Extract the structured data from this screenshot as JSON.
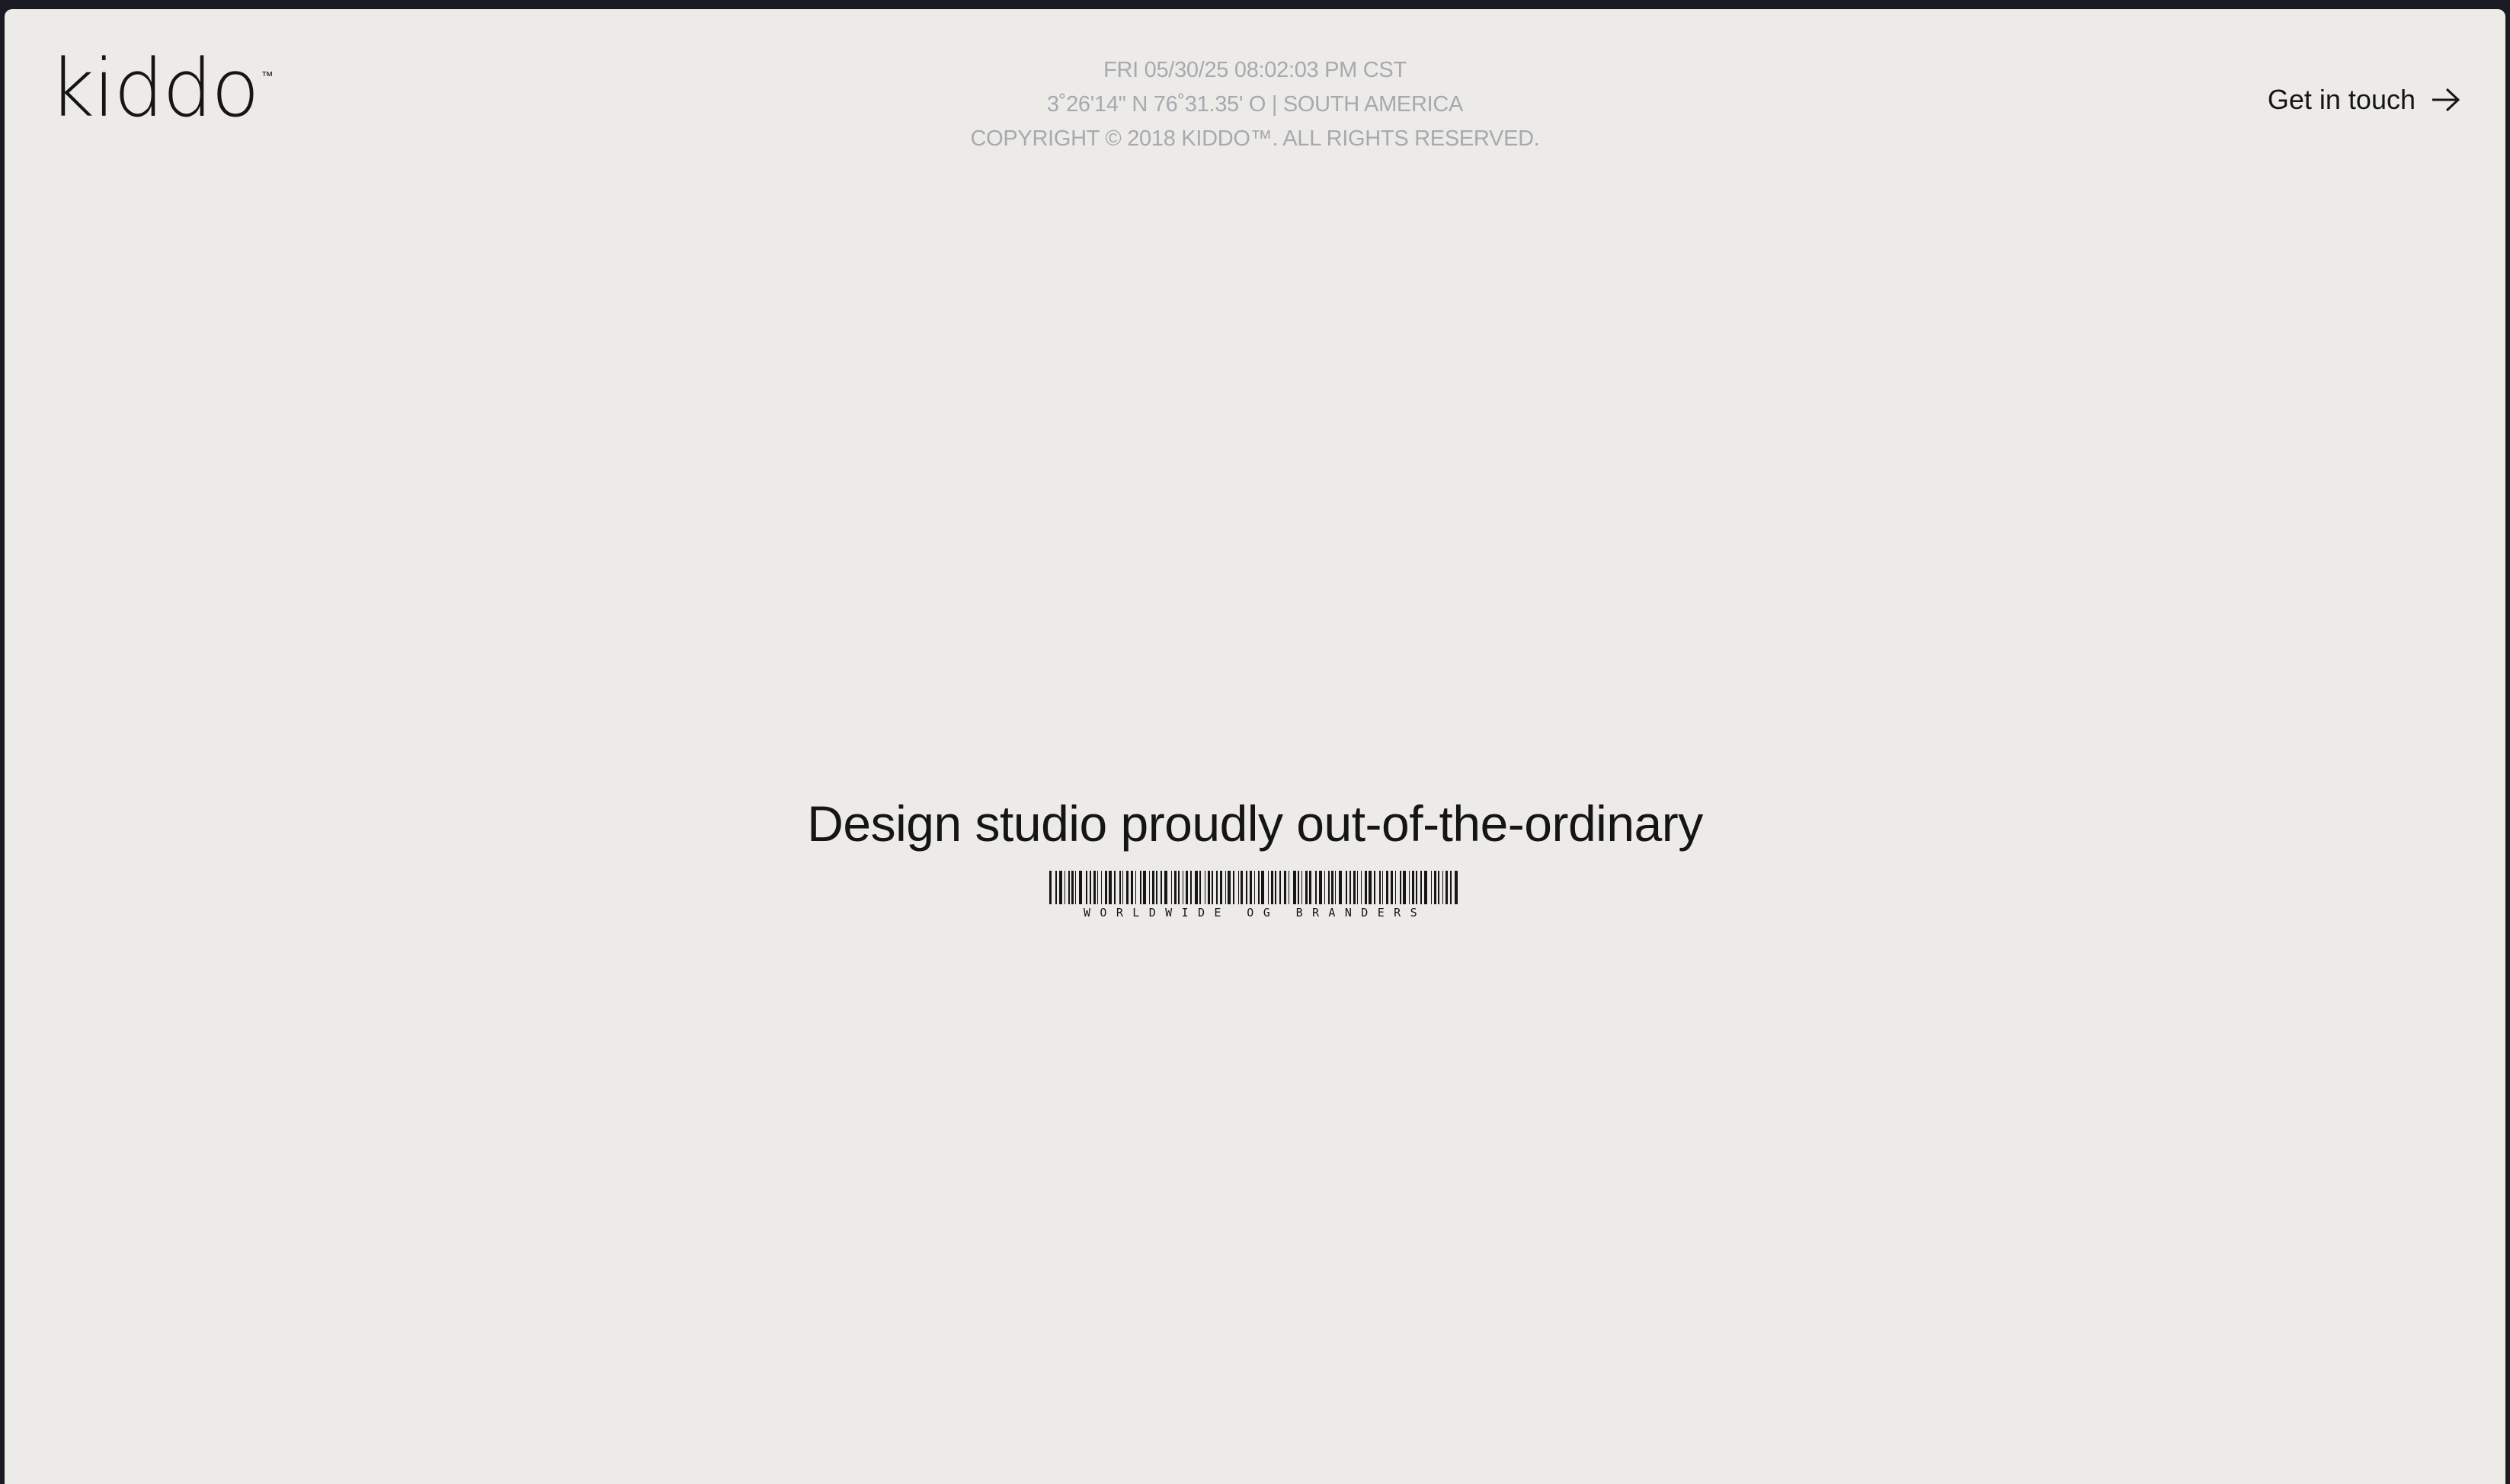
{
  "brand": {
    "name": "kiddo",
    "trademark": "™"
  },
  "header": {
    "datetime": "FRI 05/30/25 08:02:03 PM CST",
    "coordinates": "3˚26'14\" N 76˚31.35' O | SOUTH AMERICA",
    "copyright": "COPYRIGHT © 2018 KIDDO™. ALL RIGHTS RESERVED."
  },
  "cta": {
    "label": "Get in touch",
    "icon": "arrow-right-icon"
  },
  "hero": {
    "title": "Design studio proudly out-of-the-ordinary",
    "barcode_caption": "WORLDWIDE OG BRANDERS"
  },
  "colors": {
    "background": "#edebe7",
    "text": "#151515",
    "muted": "#a8a9b0",
    "window_chrome": "#1a1a22"
  }
}
